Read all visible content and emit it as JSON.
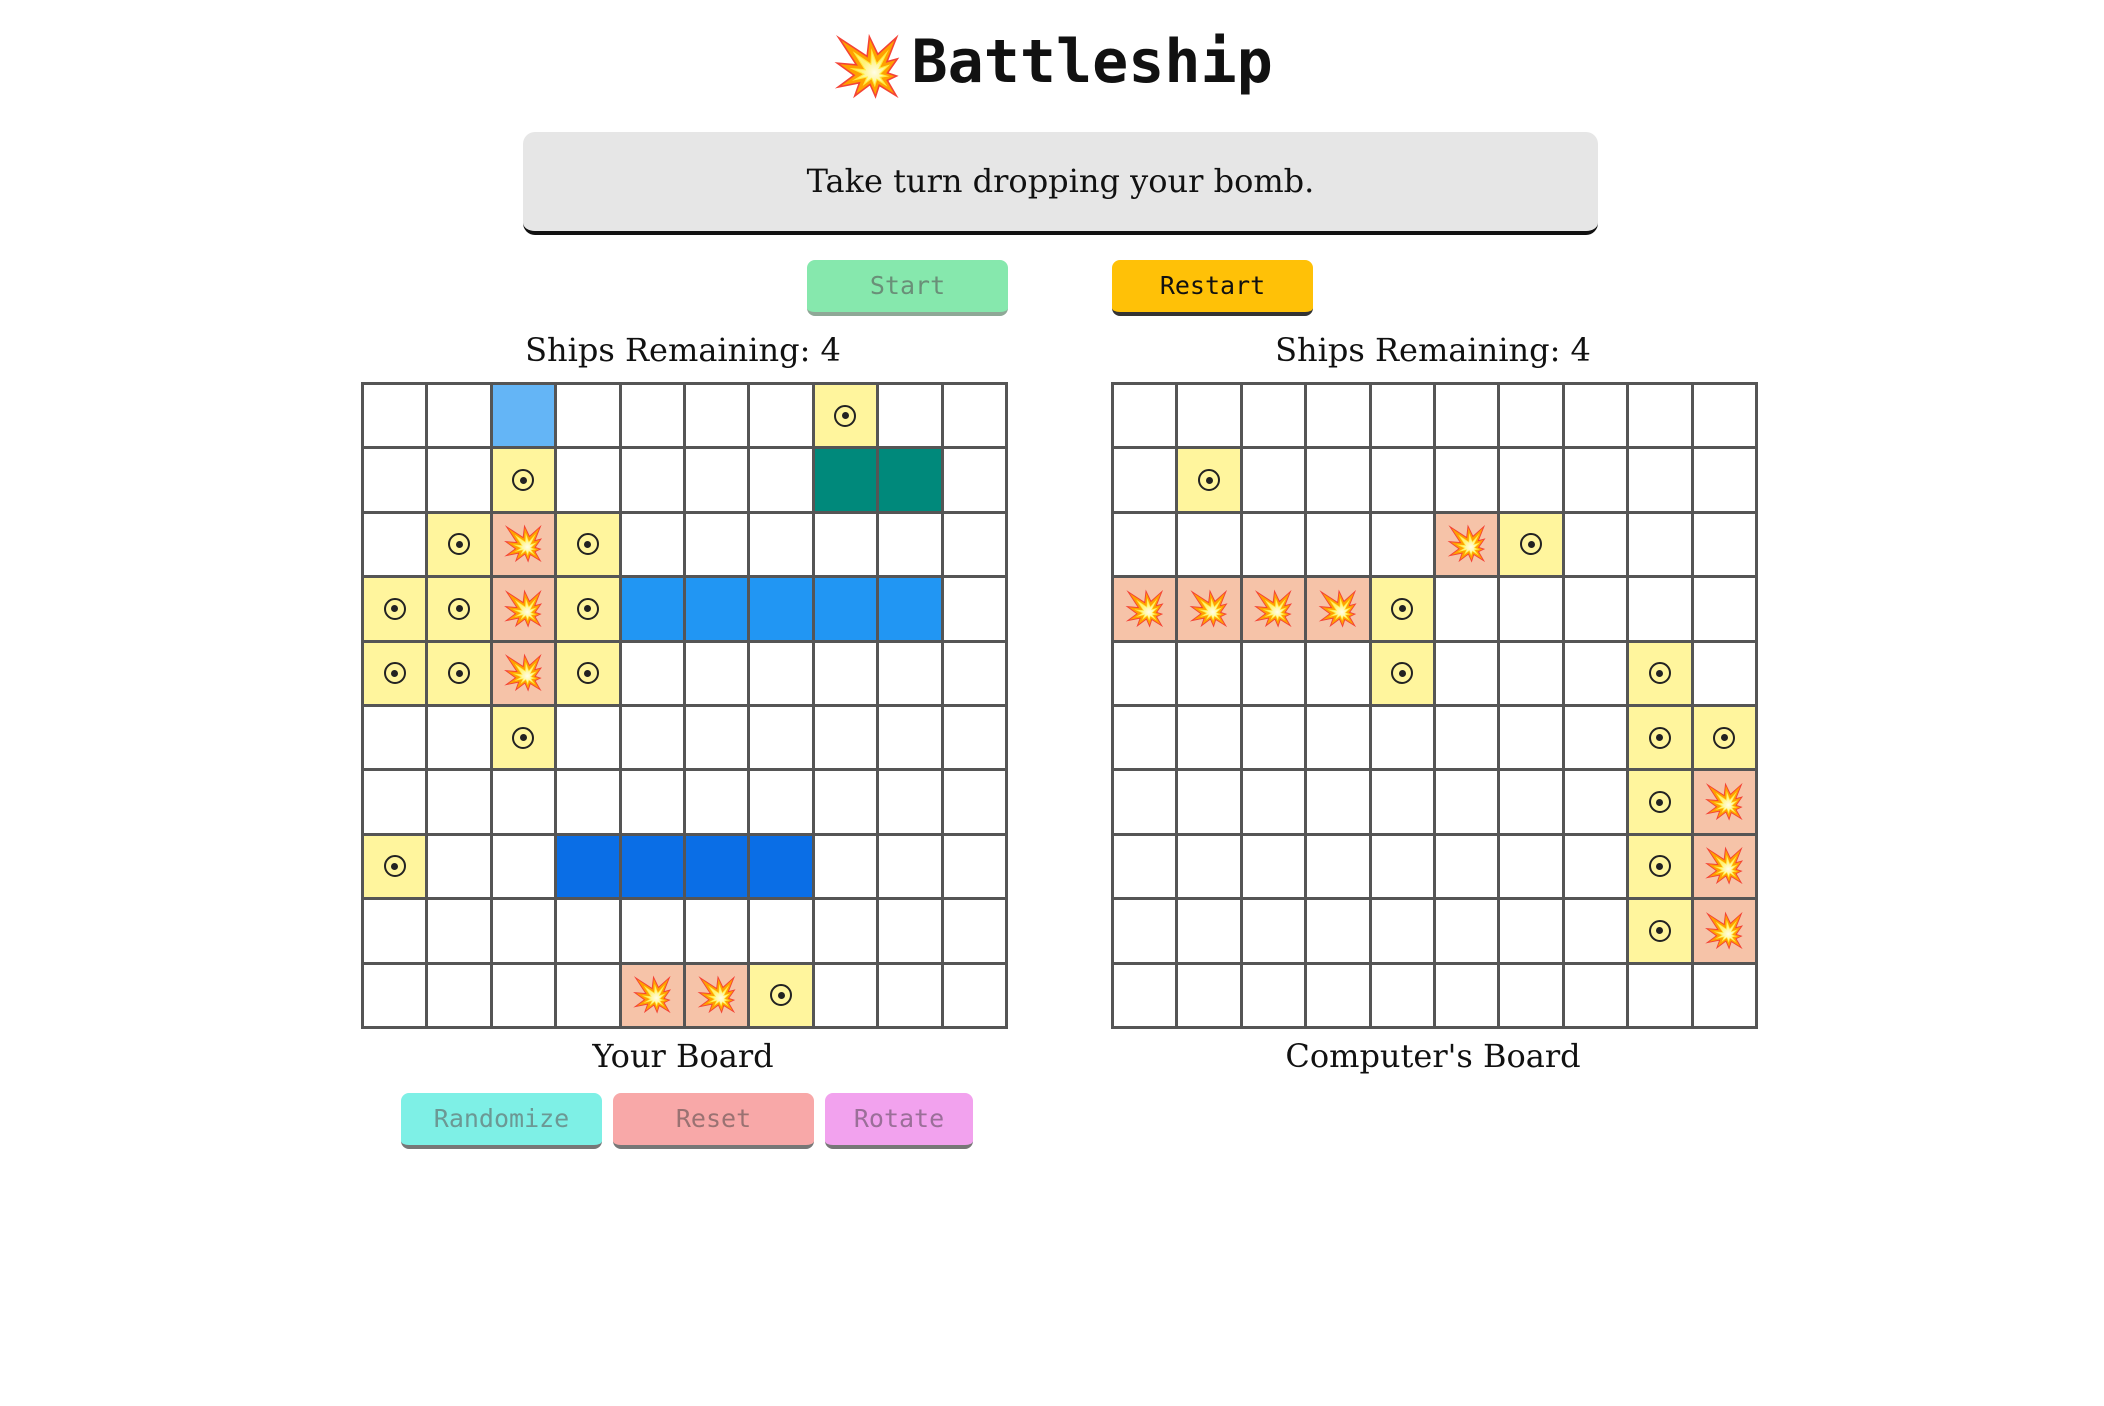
{
  "header": {
    "title": "Battleship",
    "title_icon": "💥"
  },
  "status": {
    "message": "Take turn dropping your bomb."
  },
  "controls": {
    "start_label": "Start",
    "restart_label": "Restart",
    "randomize_label": "Randomize",
    "reset_label": "Reset",
    "rotate_label": "Rotate"
  },
  "player": {
    "ships_remaining_label": "Ships Remaining: 4",
    "board_label": "Your Board"
  },
  "computer": {
    "ships_remaining_label": "Ships Remaining: 4",
    "board_label": "Computer's Board"
  },
  "icons": {
    "hit": "💥",
    "miss": "target-icon"
  },
  "colors": {
    "miss": "#fff59d",
    "hit": "#f6c3a8",
    "ship_a": "#64b5f6",
    "ship_b": "#00897b",
    "ship_c": "#2196f3",
    "ship_d": "#0a6ee6",
    "start": "#86e8ad",
    "restart": "#ffc107",
    "randomize": "#7ef0e6",
    "reset": "#f8a8a8",
    "rotate": "#f2a2ee"
  },
  "boards": {
    "legend": ". empty, o miss, X hit, A-D own ship colors",
    "player_rows": [
      "..A....o..",
      "..o....BB.",
      ".oXo......",
      "ooXoCCCCC.",
      "ooXo......",
      "..o.......",
      "..........",
      "o..DDDD...",
      "..........",
      "....XXo..."
    ],
    "computer_rows": [
      "..........",
      ".o........",
      ".....Xo...",
      "XXXXo.....",
      "....o...o.",
      "........oo",
      "........oX",
      "........oX",
      "........oX",
      ".........."
    ]
  }
}
